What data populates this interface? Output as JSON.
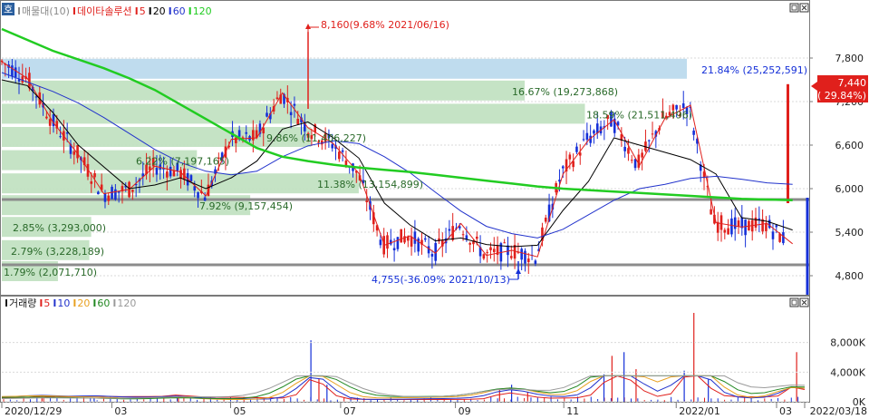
{
  "main_panel": {
    "badge": "호",
    "legend": [
      {
        "text": "매물대(10)",
        "color": "#8a8a8a"
      },
      {
        "text": "데이타솔루션",
        "color": "#e0201c"
      },
      {
        "text": "5",
        "color": "#e0201c"
      },
      {
        "text": "20",
        "color": "#000000"
      },
      {
        "text": "60",
        "color": "#2233cc"
      },
      {
        "text": "120",
        "color": "#22cc22"
      }
    ],
    "high_annotation": "8,160(9.68% 2021/06/16)",
    "low_annotation": "4,755(-36.09% 2021/10/13)",
    "current_price": "7,440",
    "current_change": "( 29.84%)"
  },
  "volume_panel": {
    "legend": [
      {
        "text": "거래량",
        "color": "#1a1a1a"
      },
      {
        "text": "5",
        "color": "#e0201c"
      },
      {
        "text": "10",
        "color": "#2233cc"
      },
      {
        "text": "20",
        "color": "#e8a020"
      },
      {
        "text": "60",
        "color": "#228822"
      },
      {
        "text": "120",
        "color": "#9a9a9a"
      }
    ]
  },
  "colors": {
    "up": "#e0201c",
    "down": "#1530d8",
    "ma5": "#e0201c",
    "ma20": "#000000",
    "ma60": "#2233cc",
    "ma120": "#22cc22",
    "profile": "#bfe0bf",
    "profile_top": "#b8d8ec",
    "support": "#8c8c8c"
  },
  "chart_data": [
    {
      "type": "line",
      "title": "데이타솔루션",
      "x_labels": [
        "2020/12/29",
        "03",
        "05",
        "07",
        "09",
        "11",
        "2022/01",
        "03",
        "2022/03/18"
      ],
      "y_ticks": [
        "7,800",
        "7,200",
        "6,600",
        "6,000",
        "5,400",
        "4,800"
      ],
      "ylim": [
        4550,
        8350
      ],
      "series": [
        {
          "name": "5",
          "values": [
            7750,
            7520,
            6920,
            6470,
            5930,
            5990,
            6310,
            6230,
            5900,
            6680,
            6700,
            7320,
            6840,
            6620,
            6210,
            5220,
            5350,
            5110,
            5520,
            5080,
            5150,
            5060,
            6200,
            6670,
            6950,
            6320,
            6970,
            7150,
            5530,
            5470,
            5520,
            5240
          ]
        },
        {
          "name": "20",
          "values": [
            7500,
            7420,
            7050,
            6600,
            6300,
            6000,
            6050,
            6150,
            6000,
            6150,
            6380,
            6820,
            6920,
            6700,
            6420,
            5800,
            5500,
            5280,
            5320,
            5230,
            5200,
            5220,
            5700,
            6100,
            6700,
            6600,
            6500,
            6400,
            6200,
            5600,
            5550,
            5430
          ]
        },
        {
          "name": "60",
          "values": [
            7600,
            7470,
            7340,
            7180,
            6980,
            6760,
            6540,
            6360,
            6240,
            6190,
            6240,
            6440,
            6590,
            6660,
            6620,
            6440,
            6220,
            5950,
            5690,
            5480,
            5380,
            5320,
            5440,
            5640,
            5840,
            6000,
            6060,
            6140,
            6170,
            6130,
            6080,
            6060
          ]
        },
        {
          "name": "120",
          "values": [
            8200,
            8050,
            7900,
            7780,
            7660,
            7520,
            7360,
            7160,
            6960,
            6760,
            6560,
            6440,
            6380,
            6330,
            6290,
            6260,
            6230,
            6190,
            6150,
            6110,
            6070,
            6030,
            6000,
            5980,
            5960,
            5940,
            5920,
            5900,
            5880,
            5860,
            5850,
            5840
          ]
        }
      ],
      "volume_profile": [
        {
          "price": 7640,
          "pct": "21.84%",
          "volume": "25,252,591"
        },
        {
          "price": 7340,
          "pct": "16.67%",
          "volume": "19,273,868"
        },
        {
          "price": 7020,
          "pct": "18.59%",
          "volume": "21,511,496"
        },
        {
          "price": 6700,
          "pct": "9.86%",
          "volume": "11,406,227"
        },
        {
          "price": 6380,
          "pct": "6.22%",
          "volume": "7,197,165"
        },
        {
          "price": 6060,
          "pct": "11.38%",
          "volume": "13,154,899"
        },
        {
          "price": 5760,
          "pct": "7.92%",
          "volume": "9,157,454"
        },
        {
          "price": 5460,
          "pct": "2.85%",
          "volume": "3,293,000"
        },
        {
          "price": 5140,
          "pct": "2.79%",
          "volume": "3,228,189"
        },
        {
          "price": 4850,
          "pct": "1.79%",
          "volume": "2,071,710"
        }
      ],
      "horizontal_lines": [
        5850,
        4950
      ],
      "high": {
        "value": 8160,
        "date": "2021/06/16",
        "pct": "9.68%"
      },
      "low": {
        "value": 4755,
        "date": "2021/10/13",
        "pct": "-36.09%"
      },
      "last": {
        "value": 7440,
        "pct": "29.84%",
        "date": "2022/03/18"
      }
    },
    {
      "type": "bar",
      "title": "거래량",
      "y_ticks": [
        "8,000K",
        "4,000K",
        "0K"
      ],
      "ylim": [
        0,
        12000
      ],
      "spikes": [
        {
          "pos": 0.05,
          "value": 700
        },
        {
          "pos": 0.115,
          "value": 500
        },
        {
          "pos": 0.22,
          "value": 900
        },
        {
          "pos": 0.385,
          "value": 8300
        },
        {
          "pos": 0.395,
          "value": 3100
        },
        {
          "pos": 0.405,
          "value": 2300
        },
        {
          "pos": 0.62,
          "value": 1700
        },
        {
          "pos": 0.635,
          "value": 2300
        },
        {
          "pos": 0.655,
          "value": 1300
        },
        {
          "pos": 0.75,
          "value": 3700
        },
        {
          "pos": 0.76,
          "value": 6200
        },
        {
          "pos": 0.775,
          "value": 6700
        },
        {
          "pos": 0.79,
          "value": 4400
        },
        {
          "pos": 0.85,
          "value": 4200
        },
        {
          "pos": 0.862,
          "value": 12000
        },
        {
          "pos": 0.88,
          "value": 3000
        },
        {
          "pos": 0.99,
          "value": 6700
        }
      ]
    }
  ]
}
